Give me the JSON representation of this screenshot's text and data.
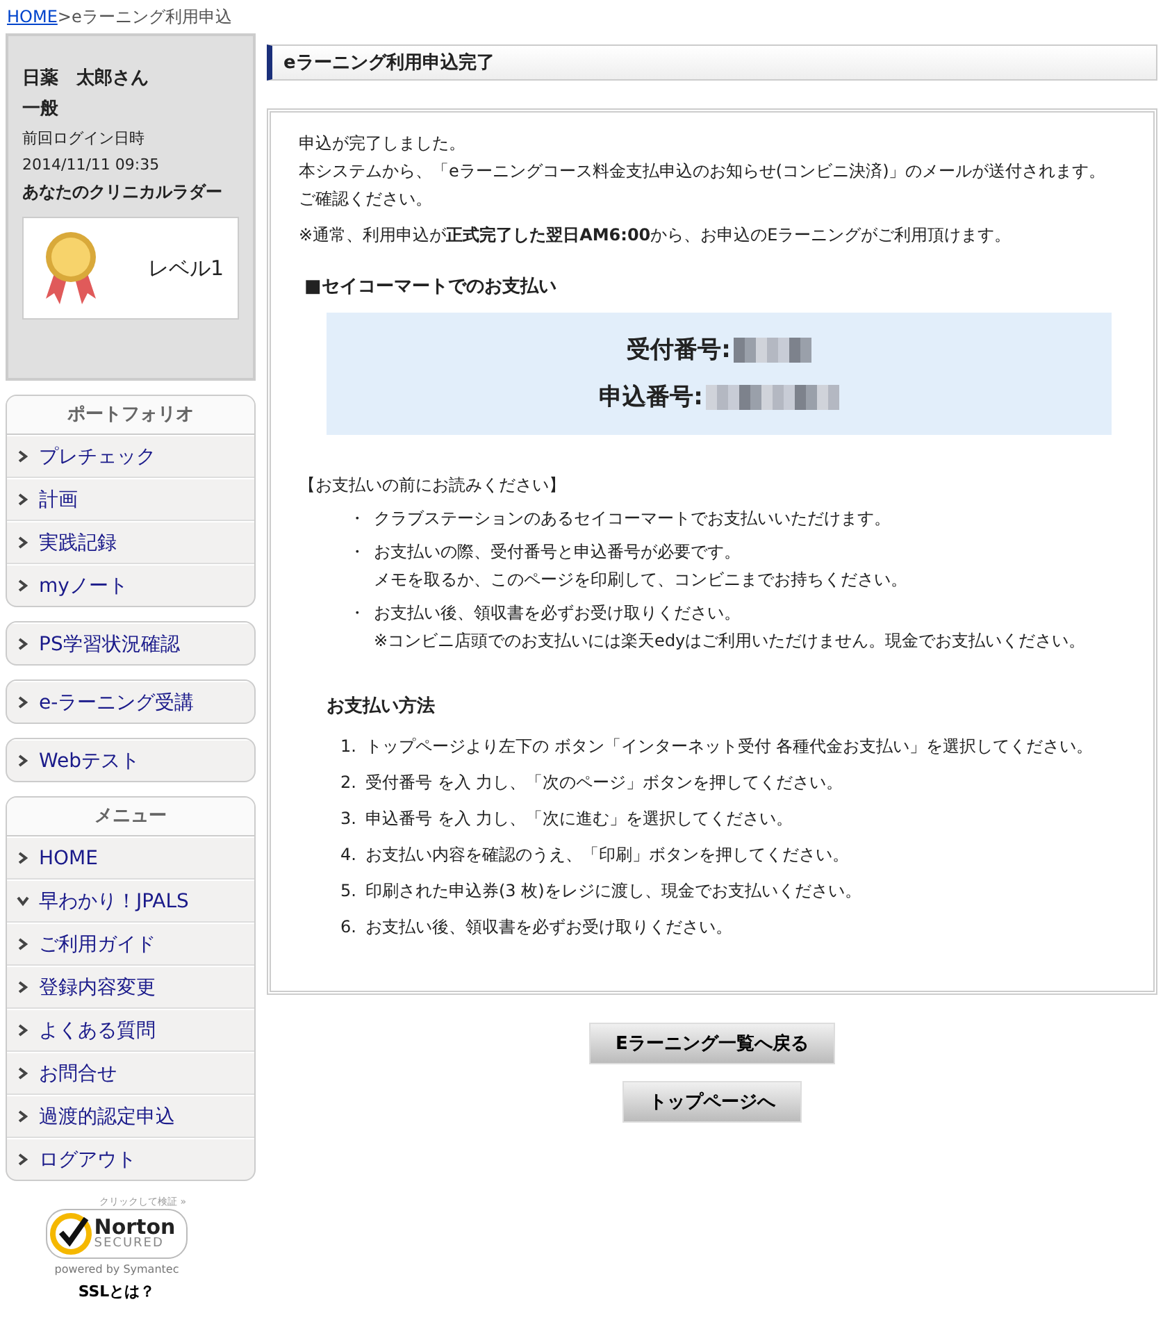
{
  "breadcrumb": {
    "home": "HOME",
    "current": ">eラーニング利用申込"
  },
  "user": {
    "name": "日薬　太郎さん",
    "type": "一般",
    "last_login_label": "前回ログイン日時",
    "last_login": "2014/11/11 09:35",
    "ladder_label": "あなたのクリニカルラダー",
    "level": "レベル1"
  },
  "nav_groups": [
    {
      "heading": "ポートフォリオ",
      "items": [
        {
          "label": "プレチェック",
          "expanded": false
        },
        {
          "label": "計画",
          "expanded": false
        },
        {
          "label": "実践記録",
          "expanded": false
        },
        {
          "label": "myノート",
          "expanded": false
        }
      ]
    },
    {
      "items": [
        {
          "label": "PS学習状況確認",
          "expanded": false
        }
      ]
    },
    {
      "items": [
        {
          "label": "e-ラーニング受講",
          "expanded": false
        }
      ]
    },
    {
      "items": [
        {
          "label": "Webテスト",
          "expanded": false
        }
      ]
    },
    {
      "heading": "メニュー",
      "items": [
        {
          "label": "HOME",
          "expanded": false
        },
        {
          "label": "早わかり！JPALS",
          "expanded": true
        },
        {
          "label": "ご利用ガイド",
          "expanded": false
        },
        {
          "label": "登録内容変更",
          "expanded": false
        },
        {
          "label": "よくある質問",
          "expanded": false
        },
        {
          "label": "お問合せ",
          "expanded": false
        },
        {
          "label": "過渡的認定申込",
          "expanded": false
        },
        {
          "label": "ログアウト",
          "expanded": false
        }
      ]
    }
  ],
  "norton": {
    "verify": "クリックして検証 »",
    "brand": "Norton",
    "secured": "SECURED",
    "powered": "powered by Symantec",
    "ssl_link": "SSLとは？"
  },
  "page_title": "eラーニング利用申込完了",
  "messages": [
    "申込が完了しました。",
    "本システムから、「eラーニングコース料金支払申込のお知らせ(コンビニ決済)」のメールが送付されます。",
    "ご確認ください。"
  ],
  "notice": "※通常、利用申込が**正式完了した翌日AM6:00**から、お申込のEラーニングがご利用頂けます。",
  "payment": {
    "heading": "■セイコーマートでのお支払い",
    "numbers": [
      {
        "label": "受付番号:"
      },
      {
        "label": "申込番号:"
      }
    ],
    "notes_heading": "【お支払いの前にお読みください】",
    "notes": [
      {
        "bullet": "・",
        "lines": [
          "クラブステーションのあるセイコーマートでお支払いいただけます。"
        ]
      },
      {
        "bullet": "・",
        "lines": [
          "お支払いの際、受付番号と申込番号が必要です。",
          "メモを取るか、このページを印刷して、コンビニまでお持ちください。"
        ]
      },
      {
        "bullet": "・",
        "lines": [
          "お支払い後、領収書を必ずお受け取りください。",
          "※コンビニ店頭でのお支払いには楽天edyはご利用いただけません。現金でお支払いください。"
        ]
      }
    ],
    "method_heading": "お支払い方法",
    "steps": [
      {
        "number": "1.",
        "text": "トップページより左下の ボタン「インターネット受付 各種代金お支払い」を選択してください。"
      },
      {
        "number": "2.",
        "text": "受付番号 を入 力し、「次のページ」ボタンを押してください。"
      },
      {
        "number": "3.",
        "text": "申込番号 を入 力し、「次に進む」を選択してください。"
      },
      {
        "number": "4.",
        "text": "お支払い内容を確認のうえ、「印刷」ボタンを押してください。"
      },
      {
        "number": "5.",
        "text": "印刷された申込券(3 枚)をレジに渡し、現金でお支払いください。"
      },
      {
        "number": "6.",
        "text": "お支払い後、領収書を必ずお受け取りください。"
      }
    ]
  },
  "buttons": [
    "Eラーニング一覧へ戻る",
    "トップページへ"
  ]
}
